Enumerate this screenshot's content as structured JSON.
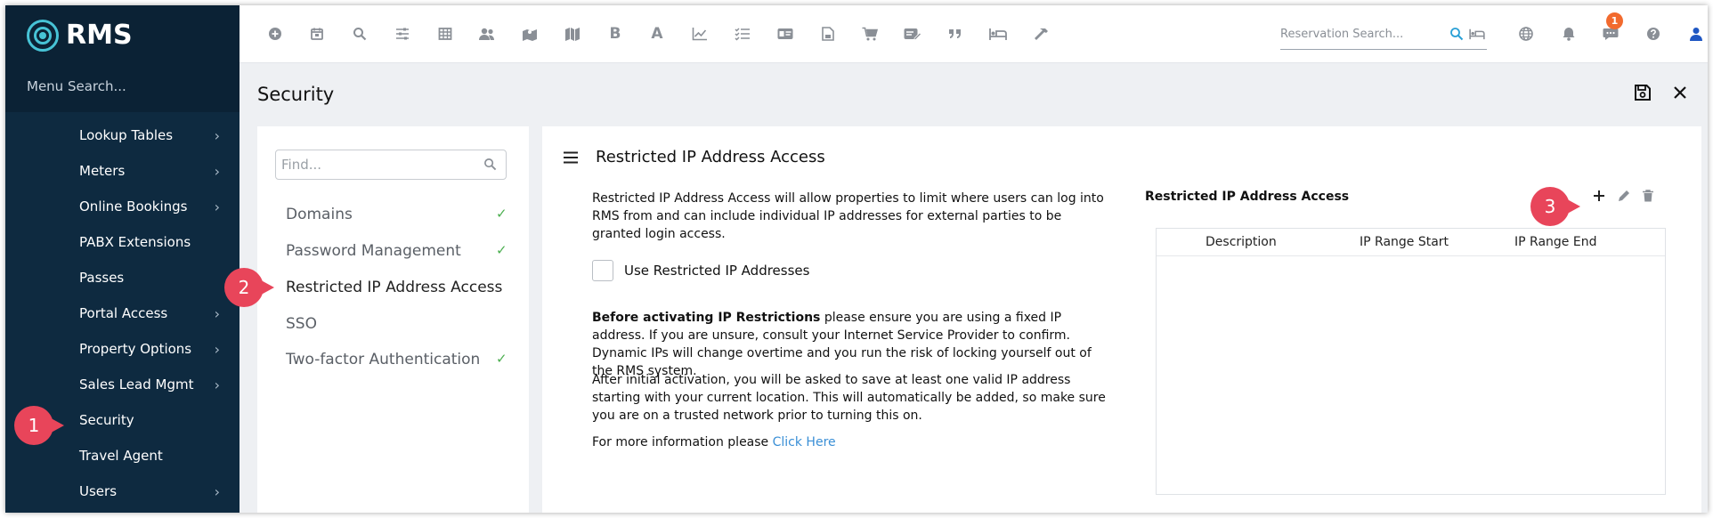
{
  "brand": {
    "name": "RMS",
    "accent": "#47c3d6"
  },
  "sidebar": {
    "menu_search": "Menu Search...",
    "items": [
      {
        "label": "Lookup Tables",
        "chevron": true
      },
      {
        "label": "Meters",
        "chevron": true
      },
      {
        "label": "Online Bookings",
        "chevron": true
      },
      {
        "label": "PABX Extensions",
        "chevron": false
      },
      {
        "label": "Passes",
        "chevron": false
      },
      {
        "label": "Portal Access",
        "chevron": true
      },
      {
        "label": "Property Options",
        "chevron": true
      },
      {
        "label": "Sales Lead Mgmt",
        "chevron": true
      },
      {
        "label": "Security",
        "chevron": false
      },
      {
        "label": "Travel Agent",
        "chevron": false
      },
      {
        "label": "Users",
        "chevron": true
      }
    ]
  },
  "toolbar": {
    "icons": [
      "add-circle-icon",
      "calendar-icon",
      "search-icon",
      "sliders-icon",
      "grid-icon",
      "users-icon",
      "map-pin-icon",
      "map-icon",
      "bold-icon",
      "font-icon",
      "chart-icon",
      "checklist-icon",
      "id-card-icon",
      "document-icon",
      "cart-icon",
      "edit-card-icon",
      "quote-icon",
      "bed-icon",
      "hammer-icon"
    ],
    "bold_glyph": "B",
    "font_glyph": "A",
    "reservation_search_placeholder": "Reservation Search...",
    "notification_count": "1",
    "badge_color": "#f26a2e"
  },
  "page": {
    "title": "Security"
  },
  "submenu": {
    "find_placeholder": "Find...",
    "items": [
      {
        "label": "Domains",
        "checked": true
      },
      {
        "label": "Password Management",
        "checked": true
      },
      {
        "label": "Restricted IP Address Access",
        "checked": false
      },
      {
        "label": "SSO",
        "checked": false
      },
      {
        "label": "Two-factor Authentication",
        "checked": true
      }
    ]
  },
  "detail": {
    "title": "Restricted IP Address Access",
    "intro": "Restricted IP Address Access will allow properties to limit where users can log into RMS from and can include individual IP addresses for external parties to be granted login access.",
    "checkbox_label": "Use Restricted IP Addresses",
    "warning_bold": "Before activating IP Restrictions",
    "warning_text": " please ensure you are using a fixed IP address. If you are unsure, consult your Internet Service Provider to confirm. Dynamic IPs will change overtime and you run the risk of locking yourself out of the RMS system.",
    "activation_text": "After initial activation, you will be asked to save at least one valid IP address starting with your current location. This will automatically be added, so make sure you are on a trusted network prior to turning this on.",
    "more_info_text": "For more information please ",
    "more_info_link": "Click Here"
  },
  "grid": {
    "title": "Restricted IP Address Access",
    "columns": [
      "Description",
      "IP Range Start",
      "IP Range End"
    ]
  },
  "callouts": [
    "1",
    "2",
    "3"
  ],
  "callout_color": "#e8455a"
}
